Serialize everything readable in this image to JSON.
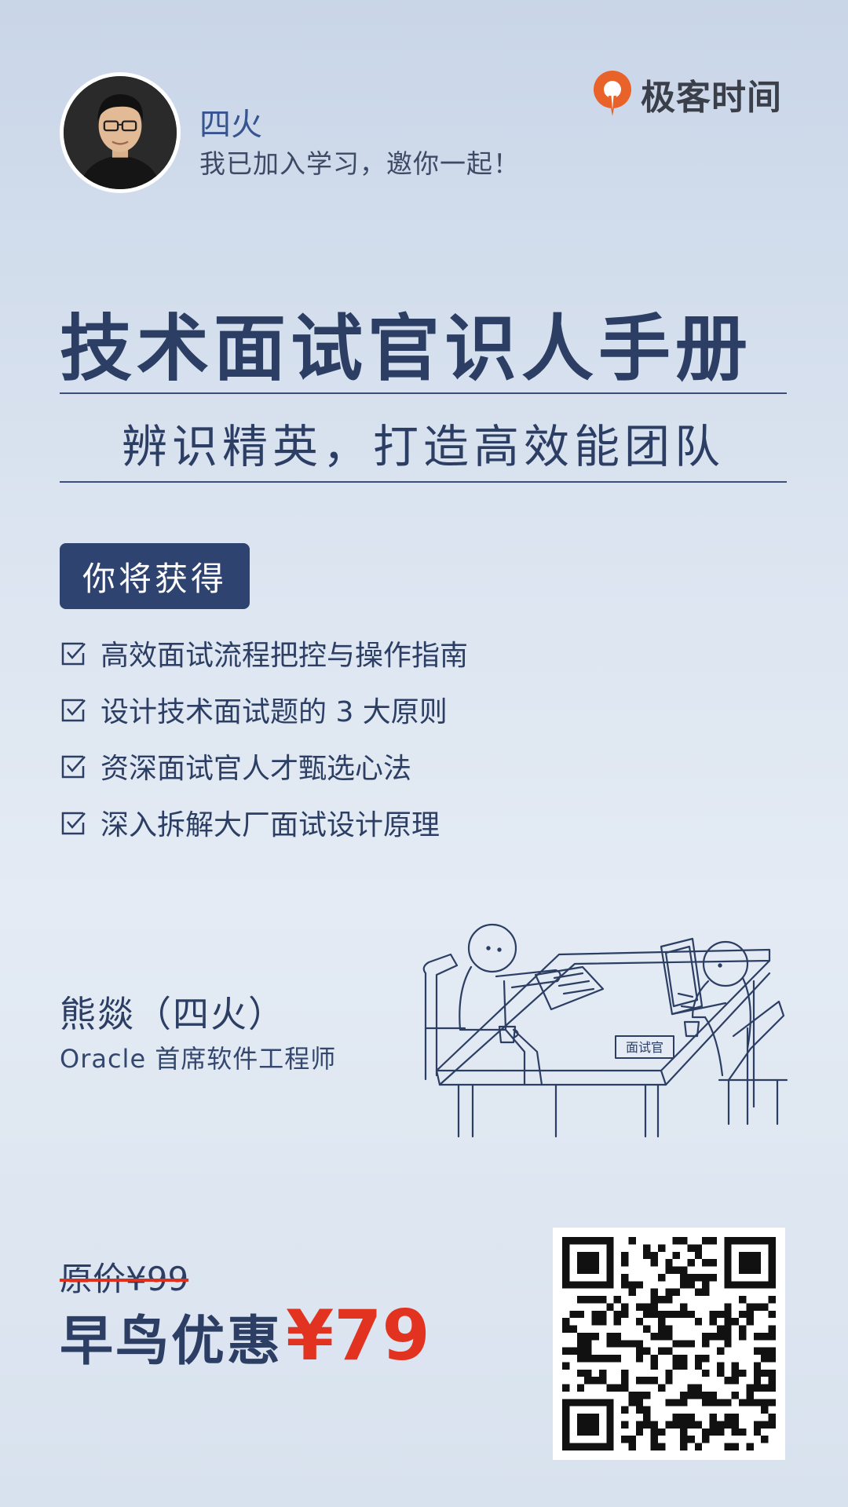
{
  "inviter": {
    "name": "四火",
    "message": "我已加入学习，邀你一起！"
  },
  "brand": {
    "name": "极客时间",
    "color": "#e8622a"
  },
  "course": {
    "title": "技术面试官识人手册",
    "subtitle": "辨识精英，打造高效能团队"
  },
  "benefits": {
    "heading": "你将获得",
    "items": [
      "高效面试流程把控与操作指南",
      "设计技术面试题的 3 大原则",
      "资深面试官人才甄选心法",
      "深入拆解大厂面试设计原理"
    ]
  },
  "author": {
    "name": "熊燚（四火）",
    "title": "Oracle 首席软件工程师"
  },
  "illustration": {
    "sign_label": "面试官"
  },
  "pricing": {
    "original": "原价¥99",
    "promo_label": "早鸟优惠",
    "promo_price": "¥79",
    "promo_color": "#e23220"
  },
  "colors": {
    "primary": "#2c3e63",
    "badge": "#2e4370"
  }
}
